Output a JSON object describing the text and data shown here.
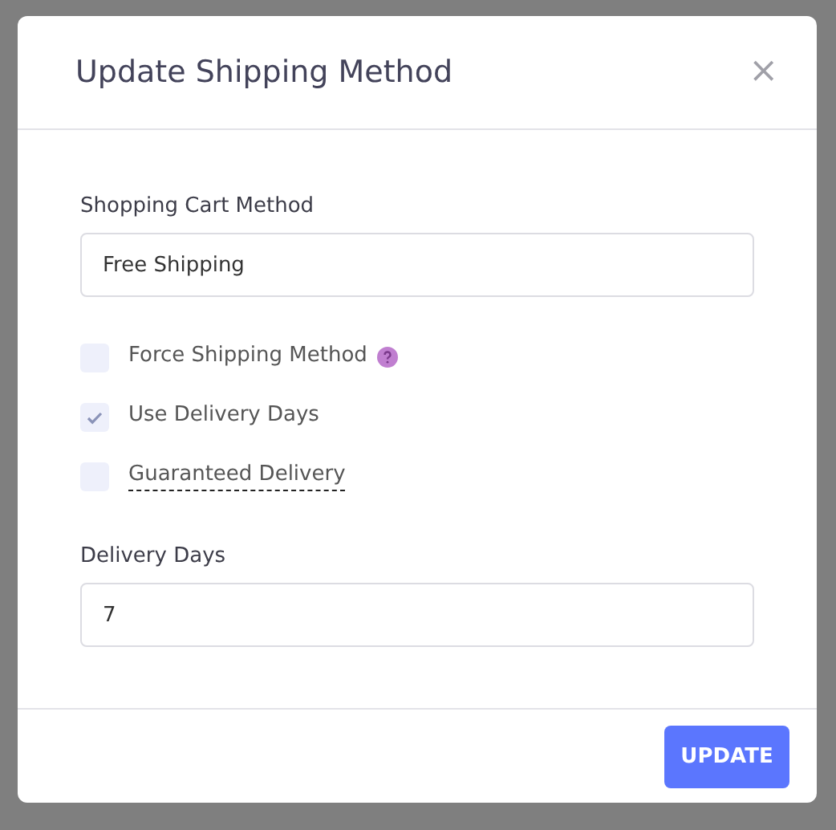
{
  "dialog": {
    "title": "Update Shipping Method",
    "close": "×"
  },
  "fields": [
    {
      "label": "Shopping Cart Method",
      "value": "Free Shipping"
    }
  ],
  "options": [
    {
      "label": "Force Shipping Method",
      "checked": false,
      "help": true,
      "underlined": false
    },
    {
      "label": "Use Delivery Days",
      "checked": true,
      "help": false,
      "underlined": false
    },
    {
      "label": "Guaranteed Delivery",
      "checked": false,
      "help": false,
      "underlined": true
    }
  ],
  "delivery": {
    "label": "Delivery Days",
    "value": "7"
  },
  "footer": {
    "button": "UPDATE"
  }
}
